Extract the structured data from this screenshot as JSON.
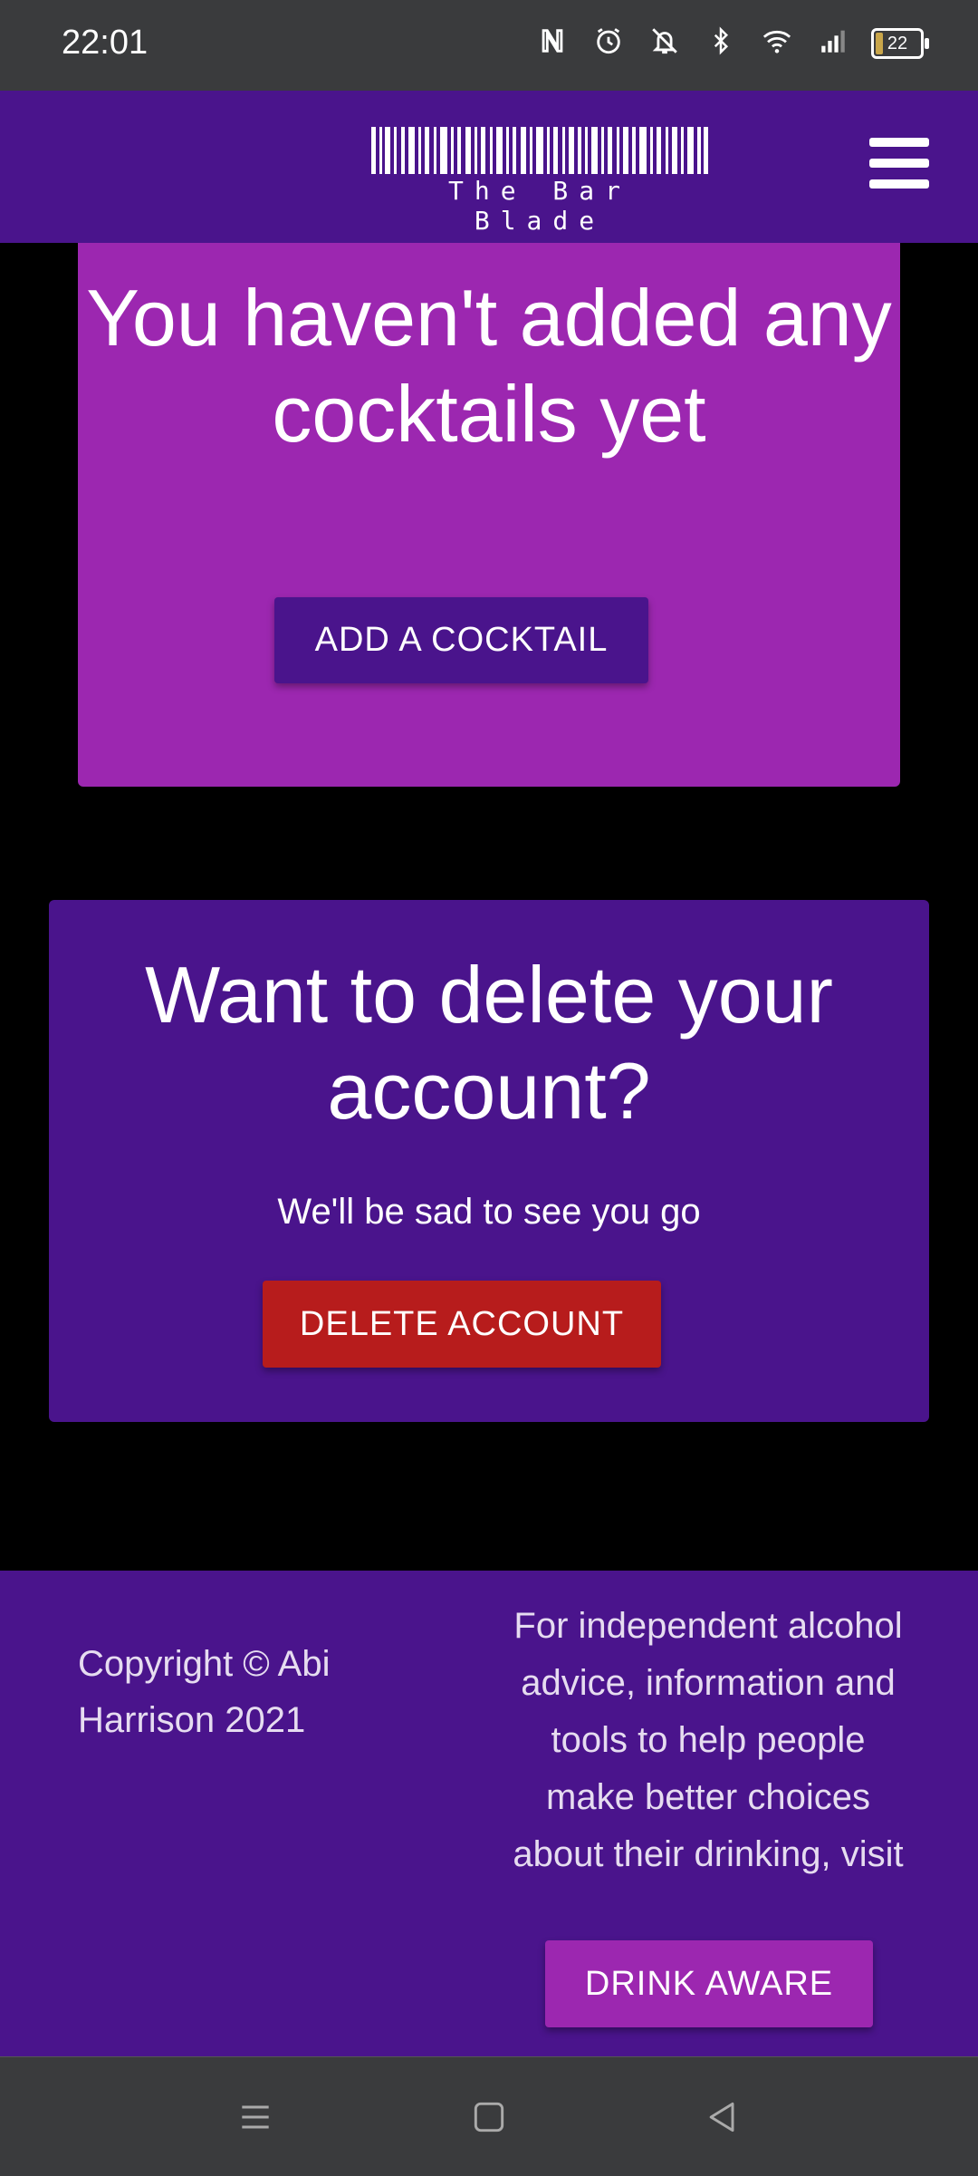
{
  "status_bar": {
    "time": "22:01",
    "icons": [
      "nfc-icon",
      "alarm-icon",
      "vibrate-icon",
      "bluetooth-icon",
      "wifi-icon",
      "signal-icon"
    ],
    "battery_level": "22"
  },
  "header": {
    "logo_text": "The Bar Blade",
    "menu_icon": "hamburger-menu-icon"
  },
  "cocktails": {
    "heading": "You haven't added any cocktails yet",
    "add_button": "ADD A COCKTAIL"
  },
  "delete_account": {
    "heading": "Want to delete your account?",
    "subtext": "We'll be sad to see you go",
    "button": "DELETE ACCOUNT"
  },
  "footer": {
    "copyright": "Copyright © Abi Harrison 2021",
    "advice": "For independent alcohol advice, information and tools to help people make better choices about their drinking, visit",
    "drink_aware_button": "DRINK AWARE"
  },
  "nav_bar": {
    "icons": [
      "recent-apps-icon",
      "home-icon",
      "back-icon"
    ]
  },
  "colors": {
    "primary": "#4a148c",
    "secondary": "#9c27b0",
    "danger": "#b71c1c",
    "system_bar": "#3a3b3d"
  }
}
